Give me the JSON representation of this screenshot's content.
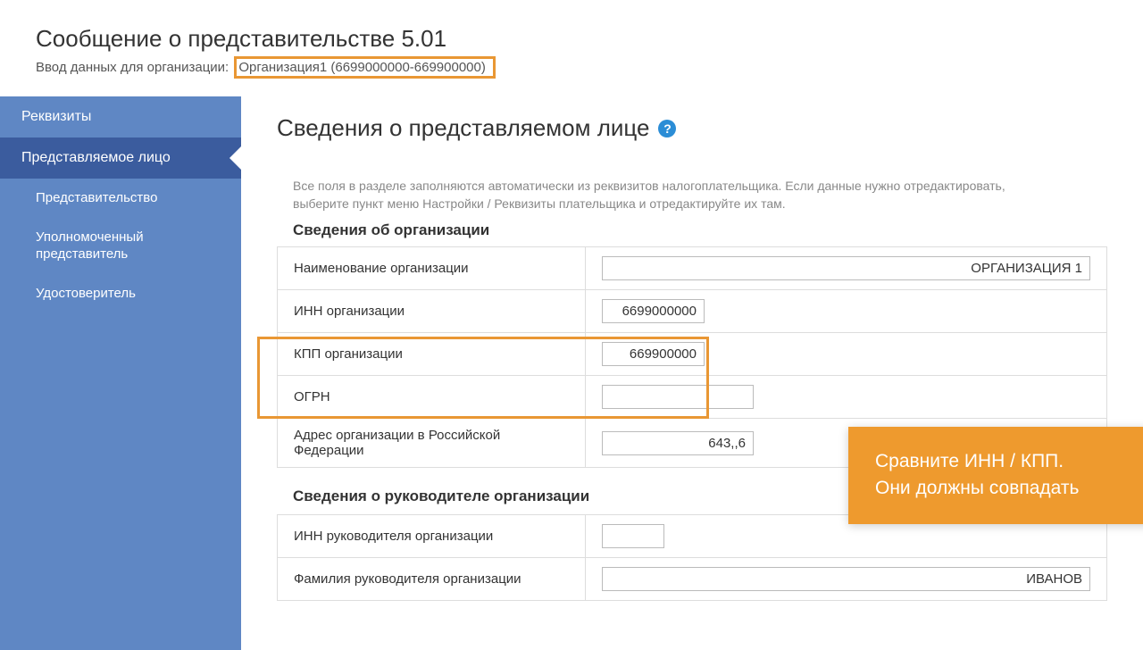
{
  "header": {
    "title": "Сообщение о представительстве 5.01",
    "subtitle_prefix": "Ввод данных для организации:",
    "subtitle_org": "Организация1 (6699000000-669900000)"
  },
  "sidebar": {
    "items": [
      {
        "label": "Реквизиты"
      },
      {
        "label": "Представляемое лицо"
      },
      {
        "label": "Представительство"
      },
      {
        "label": "Уполномоченный представитель"
      },
      {
        "label": "Удостоверитель"
      }
    ]
  },
  "main": {
    "title": "Сведения о представляемом лице",
    "help_icon": "?",
    "hint": "Все поля в разделе заполняются автоматически из реквизитов налогоплательщика. Если данные нужно отредактировать, выберите пункт меню Настройки / Реквизиты плательщика и отредактируйте их там.",
    "section_org": {
      "heading": "Сведения об организации",
      "rows": {
        "name": {
          "label": "Наименование организации",
          "value": "ОРГАНИЗАЦИЯ 1"
        },
        "inn": {
          "label": "ИНН организации",
          "value": "6699000000"
        },
        "kpp": {
          "label": "КПП организации",
          "value": "669900000"
        },
        "ogrn": {
          "label": "ОГРН",
          "value": ""
        },
        "addr": {
          "label": "Адрес организации в Российской Федерации",
          "value": "643,,6"
        }
      }
    },
    "section_leader": {
      "heading": "Сведения о руководителе организации",
      "rows": {
        "inn": {
          "label": "ИНН руководителя организации",
          "value": ""
        },
        "fam": {
          "label": "Фамилия руководителя организации",
          "value": "ИВАНОВ"
        }
      }
    }
  },
  "callout": {
    "line1": "Сравните ИНН / КПП.",
    "line2": "Они должны совпадать"
  }
}
